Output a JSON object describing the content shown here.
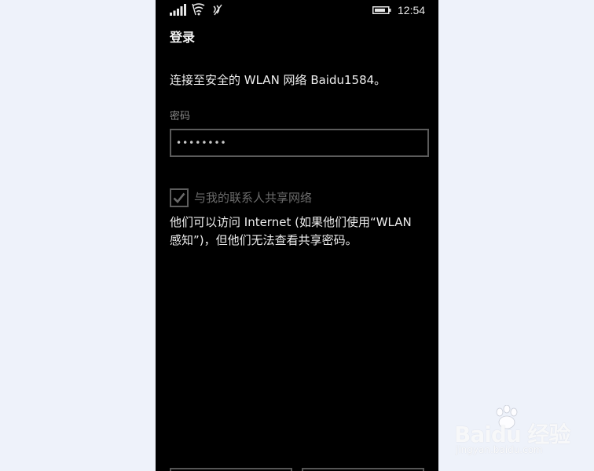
{
  "status_bar": {
    "time": "12:54",
    "icons": [
      "signal-icon",
      "wifi-icon",
      "data-icon",
      "battery-icon"
    ]
  },
  "page": {
    "title": "登录",
    "connect_message": "连接至安全的 WLAN 网络 Baidu1584。"
  },
  "password": {
    "label": "密码",
    "value": "••••••••"
  },
  "share": {
    "checked": true,
    "label": "与我的联系人共享网络",
    "description": "他们可以访问 Internet (如果他们使用“WLAN 感知”)，但他们无法查看共享密码。"
  },
  "watermark": {
    "logo_text": "Baidu 经验",
    "url": "jingyan.baidu.com"
  },
  "colors": {
    "background": "#eef2fa",
    "phone_bg": "#000000",
    "input_border": "#5b5b5b",
    "disabled_text": "#6c6c6c"
  }
}
